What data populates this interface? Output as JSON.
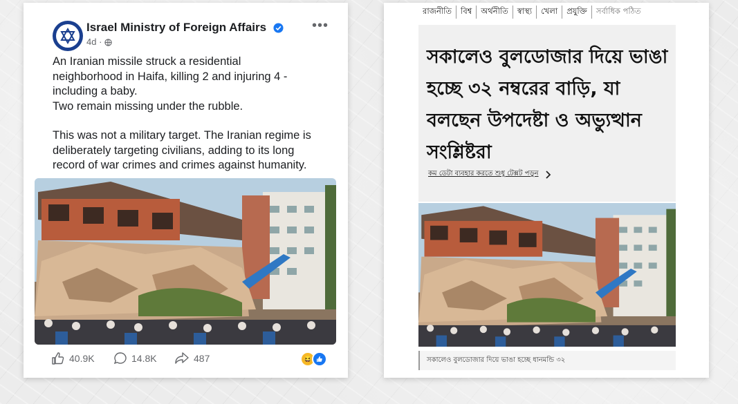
{
  "post": {
    "page_name": "Israel Ministry of Foreign Affairs",
    "time": "4d",
    "globe_icon": "globe-icon",
    "more_icon": "more-options-icon",
    "paragraph_1": [
      "An Iranian missile struck a residential",
      "neighborhood in Haifa, killing 2 and injuring 4 -",
      "including a baby.",
      "Two remain missing under the rubble."
    ],
    "paragraph_2": [
      "This was not a military target. The Iranian regime is",
      "deliberately targeting civilians, adding to its long",
      "record of war crimes and crimes against humanity."
    ],
    "likes": "40.9K",
    "comments": "14.8K",
    "shares": "487",
    "reactions": [
      "haha",
      "like"
    ],
    "photo_description_icon": "collapsed-building-photo"
  },
  "news": {
    "nav": [
      "রাজনীতি",
      "বিশ্ব",
      "অর্থনীতি",
      "স্বাস্থ্য",
      "খেলা",
      "প্রযুক্তি",
      "সর্বাধিক পঠিত"
    ],
    "headline": [
      "সকালেও বুলডোজার দিয়ে ভাঙা",
      "হচ্ছে ৩২ নম্বরের বাড়ি, যা",
      "বলছেন উপদেষ্টা ও অভ্যুত্থান",
      "সংশ্লিষ্টরা"
    ],
    "text_only_link": "কম ডেটা ব্যবহার করতে শুধু টেক্সট পড়ুন",
    "caption": "সকালেও বুলডোজার দিয়ে ভাঙা হচ্ছে ধানমন্ডি ৩২"
  },
  "colors": {
    "facebook_blue": "#1877f2",
    "avatar_blue": "#1a3f8f"
  }
}
